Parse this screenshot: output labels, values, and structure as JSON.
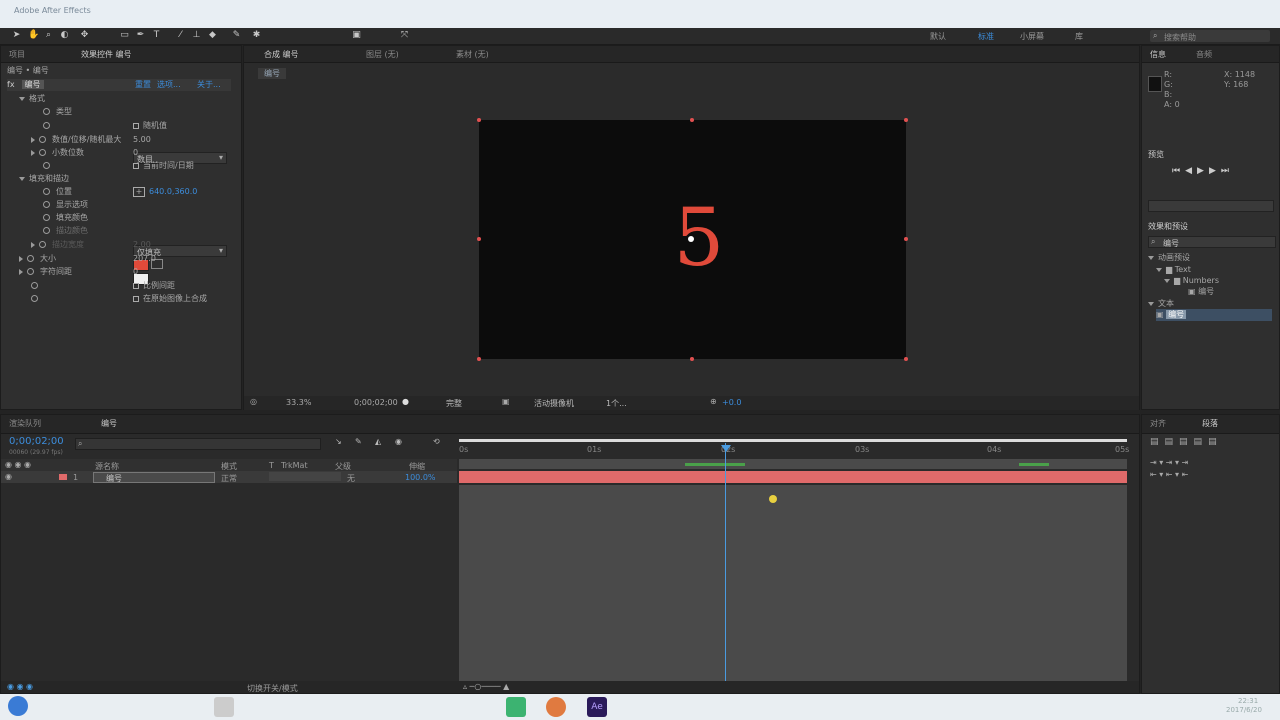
{
  "app": {
    "title": "Adobe After Effects"
  },
  "menu": {
    "workspace_items": [
      "默认",
      "标准",
      "小屏幕",
      "库"
    ],
    "search_placeholder": "搜索帮助"
  },
  "effects_panel": {
    "tabs": [
      "项目",
      "效果控件 编号"
    ],
    "breadcrumb": "编号 • 编号",
    "effect_name": "编号",
    "effect_links": [
      "重置",
      "选项...",
      "关于..."
    ],
    "rows": [
      {
        "label": "格式",
        "value": "",
        "kind": "group"
      },
      {
        "label": "类型",
        "value": "数目",
        "kind": "dropdown"
      },
      {
        "label": "",
        "value": "随机值",
        "kind": "checkbox"
      },
      {
        "label": "数值/位移/随机最大",
        "value": "5.00",
        "kind": "number"
      },
      {
        "label": "小数位数",
        "value": "0",
        "kind": "number"
      },
      {
        "label": "",
        "value": "当前时间/日期",
        "kind": "checkbox"
      },
      {
        "label": "填充和描边",
        "value": "",
        "kind": "group"
      },
      {
        "label": "位置",
        "value": "640.0,360.0",
        "kind": "point"
      },
      {
        "label": "显示选项",
        "value": "仅填充",
        "kind": "dropdown"
      },
      {
        "label": "填充颜色",
        "value": "",
        "kind": "color"
      },
      {
        "label": "描边颜色",
        "value": "",
        "kind": "color2"
      },
      {
        "label": "描边宽度",
        "value": "2.00",
        "kind": "disabled"
      },
      {
        "label": "大小",
        "value": "207.0",
        "kind": "number"
      },
      {
        "label": "字符间距",
        "value": "0",
        "kind": "number"
      },
      {
        "label": "",
        "value": "比例间距",
        "kind": "checkbox"
      },
      {
        "label": "",
        "value": "在原始图像上合成",
        "kind": "checkbox"
      }
    ]
  },
  "viewer": {
    "tabs": [
      "合成 编号",
      "图层 (无)",
      "素材 (无)"
    ],
    "comp_tab": "编号",
    "digit": "5",
    "footer": {
      "zoom": "33.3%",
      "timecode": "0;00;02;00",
      "quality": "完整",
      "camera": "活动摄像机",
      "views": "1个...",
      "exposure": "+0.0"
    }
  },
  "right_panel": {
    "info_tabs": [
      "信息",
      "音频"
    ],
    "info_lines": [
      "R:",
      "G:",
      "B:",
      "A: 0"
    ],
    "info_xy": [
      "X: 1148",
      "Y: 168"
    ],
    "preview_tab": "预览",
    "effects_presets_tab": "效果和预设",
    "search_value": "编号",
    "tree": [
      "动画预设",
      "Text",
      "Numbers",
      "编号",
      "文本",
      "编号"
    ],
    "align_tabs": [
      "对齐",
      "段落"
    ]
  },
  "timeline": {
    "tabs": [
      "渲染队列",
      "编号"
    ],
    "timecode": "0;00;02;00",
    "frames": "00060 (29.97 fps)",
    "columns": [
      "源名称",
      "模式",
      "T",
      "TrkMat",
      "父级",
      "伸缩"
    ],
    "layer": {
      "index": "1",
      "name": "编号",
      "mode": "正常",
      "parent": "无",
      "stretch": "100.0%"
    },
    "ruler_ticks": [
      "0s",
      "01s",
      "02s",
      "03s",
      "04s",
      "05s"
    ],
    "playhead_percent": 40,
    "footer": "切换开关/模式"
  },
  "taskbar": {
    "time": "22:31",
    "date": "2017/6/20"
  },
  "colors": {
    "accent": "#3c8ddc",
    "fill": "#e04a3a",
    "layer_bar": "#e06a6a"
  }
}
